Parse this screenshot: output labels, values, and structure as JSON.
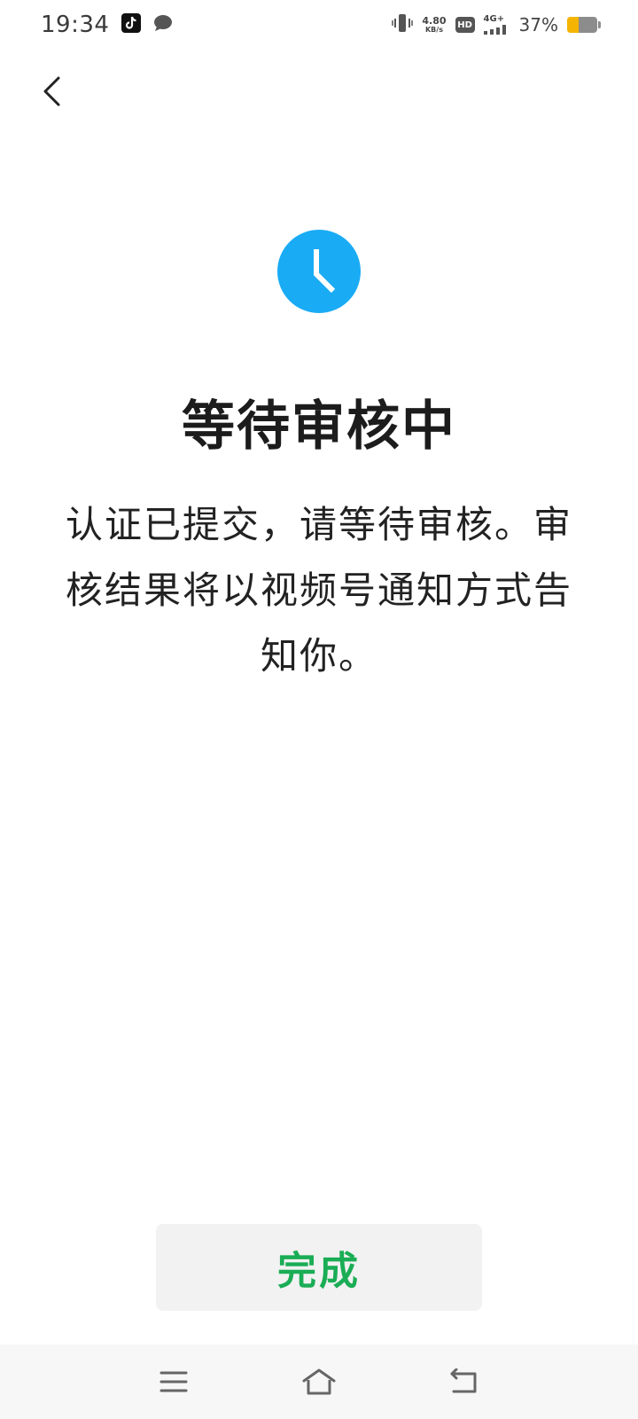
{
  "status_bar": {
    "time": "19:34",
    "notification_icons": [
      "tiktok-icon",
      "chat-bubble-icon"
    ],
    "net_speed_value": "4.80",
    "net_speed_unit": "KB/s",
    "hd_label": "HD",
    "network_gen": "4G+",
    "battery_percent": "37%",
    "battery_level": 0.37,
    "battery_color": "#f5b400"
  },
  "header": {
    "back_icon": "chevron-left-icon"
  },
  "main": {
    "status_icon": "clock-icon",
    "status_icon_color": "#1aabf5",
    "title": "等待审核中",
    "description": "认证已提交，请等待审核。审核结果将以视频号通知方式告知你。"
  },
  "footer": {
    "done_label": "完成",
    "done_color": "#1aad55"
  },
  "nav_bar": {
    "items": [
      "menu-icon",
      "home-icon",
      "back-arrow-icon"
    ]
  }
}
